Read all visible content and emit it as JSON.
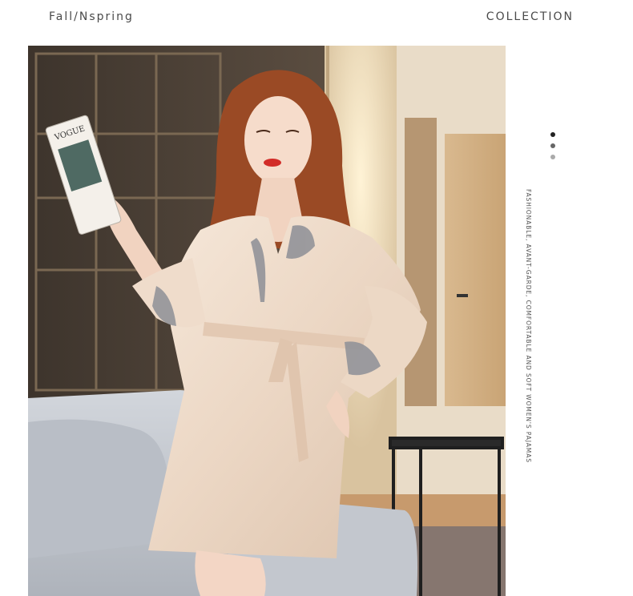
{
  "header": {
    "left_label": "Fall/Nspring",
    "right_label": "COLLECTION"
  },
  "side": {
    "tagline": "FASHIONABLE, AVANT-GARDE, COMFORTABLE AND SOFT WOMEN'S PAJAMAS",
    "dot_colors": [
      "#222222",
      "#666666",
      "#aaaaaa"
    ]
  },
  "photo": {
    "subject": "model-in-satin-robe",
    "magazine_text": "VOGUE"
  },
  "colors": {
    "robe": "#efdccb",
    "lace": "#8d8f96",
    "sofa": "#c4c8cf",
    "hair": "#9a4a25"
  }
}
